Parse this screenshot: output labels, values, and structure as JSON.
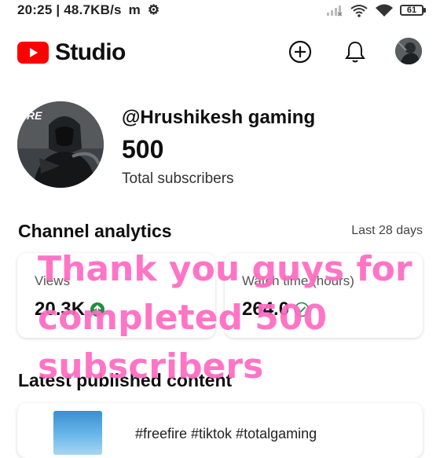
{
  "status_bar": {
    "time": "20:25 | 48.7KB/s",
    "carrier_glyph": "m",
    "battery": "61"
  },
  "header": {
    "app_name": "Studio",
    "brand_color": "#ff0000"
  },
  "channel": {
    "handle": "@Hrushikesh gaming",
    "subscriber_count": "500",
    "subscriber_label": "Total subscribers",
    "avatar_text": "RE"
  },
  "analytics": {
    "title": "Channel analytics",
    "period": "Last 28 days",
    "cards": [
      {
        "label": "Views",
        "value": "20.3K",
        "trend": "up"
      },
      {
        "label": "Watch time (hours)",
        "value": "264.0",
        "trend": "check"
      }
    ]
  },
  "latest": {
    "title": "Latest published content",
    "item_title": "#freefire #tiktok #totalgaming"
  },
  "overlay": {
    "lines": [
      "Thank you guys for",
      "completed 500",
      "subscribers"
    ],
    "color": "#ff6bc2"
  }
}
